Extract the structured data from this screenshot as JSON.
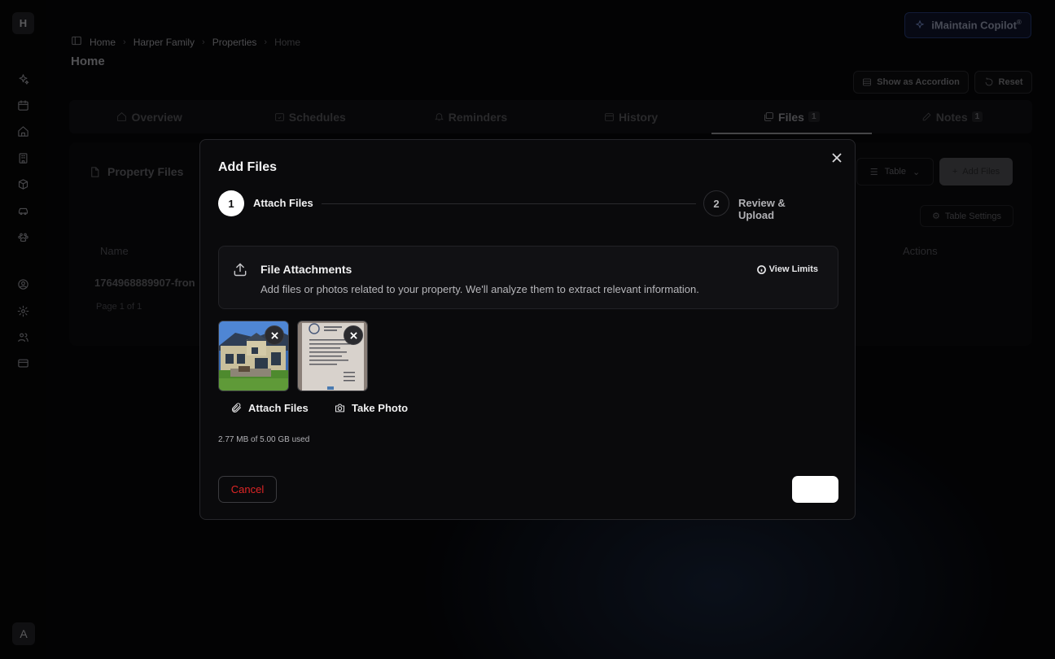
{
  "sidebar": {
    "logo_letter": "H",
    "user_initial": "A",
    "icons": [
      "copilot-icon",
      "calendar-icon",
      "home-icon",
      "building-icon",
      "box-icon",
      "car-icon",
      "pet-icon",
      "user-circle-icon",
      "gear-icon",
      "users-icon",
      "credit-card-icon"
    ]
  },
  "breadcrumb": {
    "items": [
      "Home",
      "Harper Family",
      "Properties",
      "Home"
    ]
  },
  "page": {
    "title": "Home"
  },
  "copilot": {
    "label": "iMaintain Copilot",
    "mark": "®"
  },
  "toolbar": {
    "accordion_label": "Show as Accordion",
    "reset_label": "Reset"
  },
  "tabs": [
    {
      "label": "Overview",
      "icon": "home-icon"
    },
    {
      "label": "Schedules",
      "icon": "calendar-check-icon"
    },
    {
      "label": "Reminders",
      "icon": "bell-icon"
    },
    {
      "label": "History",
      "icon": "calendar-icon"
    },
    {
      "label": "Files",
      "icon": "images-icon",
      "count": "1"
    },
    {
      "label": "Notes",
      "icon": "edit-icon",
      "count": "1"
    }
  ],
  "files_card": {
    "title": "Property Files",
    "view_select": "Table",
    "add_label": "Add Files",
    "table_settings": "Table Settings",
    "columns": [
      "Name",
      "Actions"
    ],
    "row_name": "1764968889907-fron",
    "pager_text": "Page 1 of 1"
  },
  "modal": {
    "title": "Add Files",
    "steps": [
      {
        "number": "1",
        "label": "Attach Files",
        "active": true
      },
      {
        "number": "2",
        "label": "Review & Upload",
        "active": false
      }
    ],
    "attachments": {
      "title": "File Attachments",
      "description": "Add files or photos related to your property. We'll analyze them to extract relevant information.",
      "view_limits": "View Limits"
    },
    "thumbnails": [
      "house-photo",
      "document-photo"
    ],
    "attach_files_label": "Attach Files",
    "take_photo_label": "Take Photo",
    "usage": "2.77 MB of 5.00 GB used",
    "cancel_label": "Cancel",
    "next_label": ""
  },
  "colors": {
    "cancel_text": "#e02626",
    "primary_button": "#ffffff",
    "modal_bg": "#0a0a0c"
  }
}
